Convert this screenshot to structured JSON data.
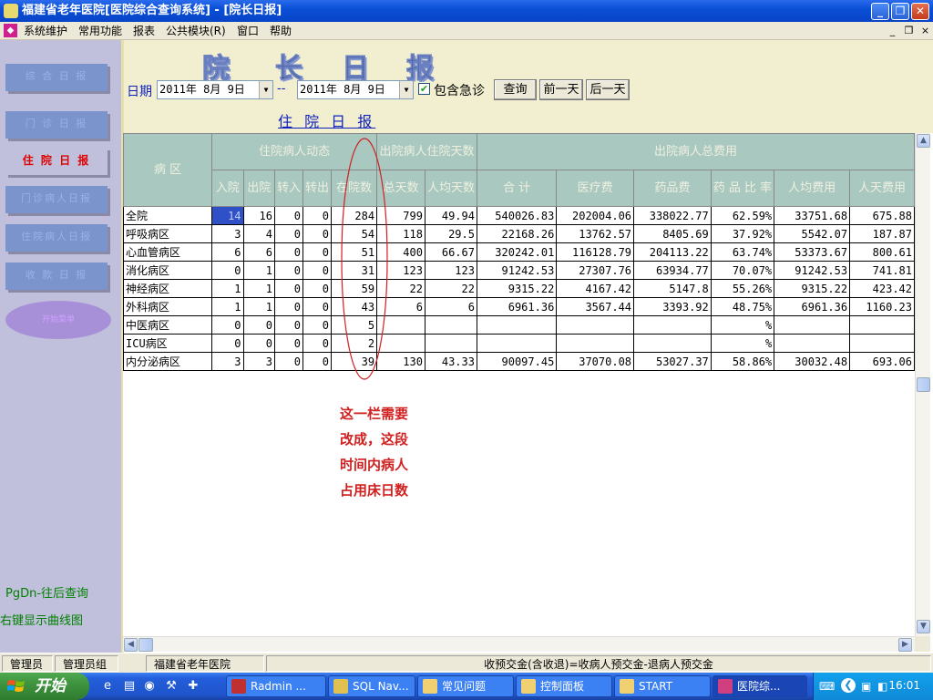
{
  "window": {
    "title": "福建省老年医院[医院综合查询系统] - [院长日报]",
    "btn_min": "_",
    "btn_max": "❐",
    "btn_close": "✕"
  },
  "menu": {
    "items": [
      "系统维护",
      "常用功能",
      "报表",
      "公共模块(R)",
      "窗口",
      "帮助"
    ],
    "mdi_min": "_",
    "mdi_restore": "❐",
    "mdi_close": "×"
  },
  "sidebar": {
    "buttons": [
      "综 合 日 报",
      "门 诊 日 报",
      "住 院 日 报",
      "门诊病人日报",
      "住院病人日报",
      "收 款 日 报",
      "开始菜单"
    ],
    "active_index": 2,
    "note_pgdn": "PgDn-往后查询",
    "note_rightclick": "右键显示曲线图"
  },
  "header": {
    "big_title_chars": [
      "院",
      "长",
      "日",
      "报"
    ],
    "date_label": "日期",
    "date_from": "2011年 8月 9日",
    "date_sep": "--",
    "date_to": "2011年 8月 9日",
    "include_emergency_label": "包含急诊",
    "include_emergency_checked": true,
    "query_button": "查询",
    "prev_day_button": "前一天",
    "next_day_button": "后一天",
    "subtitle": "住 院 日 报"
  },
  "grid": {
    "group_headers": {
      "ward": "病  区",
      "inpatient_dynamics": "住院病人动态",
      "discharge_days": "出院病人住院天数",
      "discharge_costs": "出院病人总费用"
    },
    "columns": [
      "入院",
      "出院",
      "转入",
      "转出",
      "在院数",
      "总天数",
      "人均天数",
      "合    计",
      "医疗费",
      "药品费",
      "药 品 比 率",
      "人均费用",
      "人天费用"
    ],
    "rows": [
      [
        "全院",
        "14",
        "16",
        "0",
        "0",
        "284",
        "799",
        "49.94",
        "540026.83",
        "202004.06",
        "338022.77",
        "62.59%",
        "33751.68",
        "675.88"
      ],
      [
        "呼吸病区",
        "3",
        "4",
        "0",
        "0",
        "54",
        "118",
        "29.5",
        "22168.26",
        "13762.57",
        "8405.69",
        "37.92%",
        "5542.07",
        "187.87"
      ],
      [
        "心血管病区",
        "6",
        "6",
        "0",
        "0",
        "51",
        "400",
        "66.67",
        "320242.01",
        "116128.79",
        "204113.22",
        "63.74%",
        "53373.67",
        "800.61"
      ],
      [
        "消化病区",
        "0",
        "1",
        "0",
        "0",
        "31",
        "123",
        "123",
        "91242.53",
        "27307.76",
        "63934.77",
        "70.07%",
        "91242.53",
        "741.81"
      ],
      [
        "神经病区",
        "1",
        "1",
        "0",
        "0",
        "59",
        "22",
        "22",
        "9315.22",
        "4167.42",
        "5147.8",
        "55.26%",
        "9315.22",
        "423.42"
      ],
      [
        "外科病区",
        "1",
        "1",
        "0",
        "0",
        "43",
        "6",
        "6",
        "6961.36",
        "3567.44",
        "3393.92",
        "48.75%",
        "6961.36",
        "1160.23"
      ],
      [
        "中医病区",
        "0",
        "0",
        "0",
        "0",
        "5",
        "",
        "",
        "",
        "",
        "",
        "%",
        "",
        ""
      ],
      [
        "ICU病区",
        "0",
        "0",
        "0",
        "0",
        "2",
        "",
        "",
        "",
        "",
        "",
        "%",
        "",
        ""
      ],
      [
        "内分泌病区",
        "3",
        "3",
        "0",
        "0",
        "39",
        "130",
        "43.33",
        "90097.45",
        "37070.08",
        "53027.37",
        "58.86%",
        "30032.48",
        "693.06"
      ]
    ]
  },
  "annotation": {
    "lines": [
      "这一栏需要",
      "改成，这段",
      "时间内病人",
      "占用床日数"
    ]
  },
  "statusbar": {
    "user": "管理员",
    "group": "管理员组",
    "org": "福建省老年医院",
    "formula": "收预交金(含收退)=收病人预交金-退病人预交金"
  },
  "taskbar": {
    "start_label": "开始",
    "tasks": [
      "Radmin ...",
      "SQL Nav...",
      "常见问题",
      "控制面板",
      "START",
      "医院综..."
    ],
    "active_task_index": 5,
    "clock": "16:01"
  },
  "colors": {
    "title_blue": "#0a4fd6",
    "header_teal": "#a8c8c0",
    "annotation_red": "#d02020",
    "selected_cell": "#3050c8"
  }
}
